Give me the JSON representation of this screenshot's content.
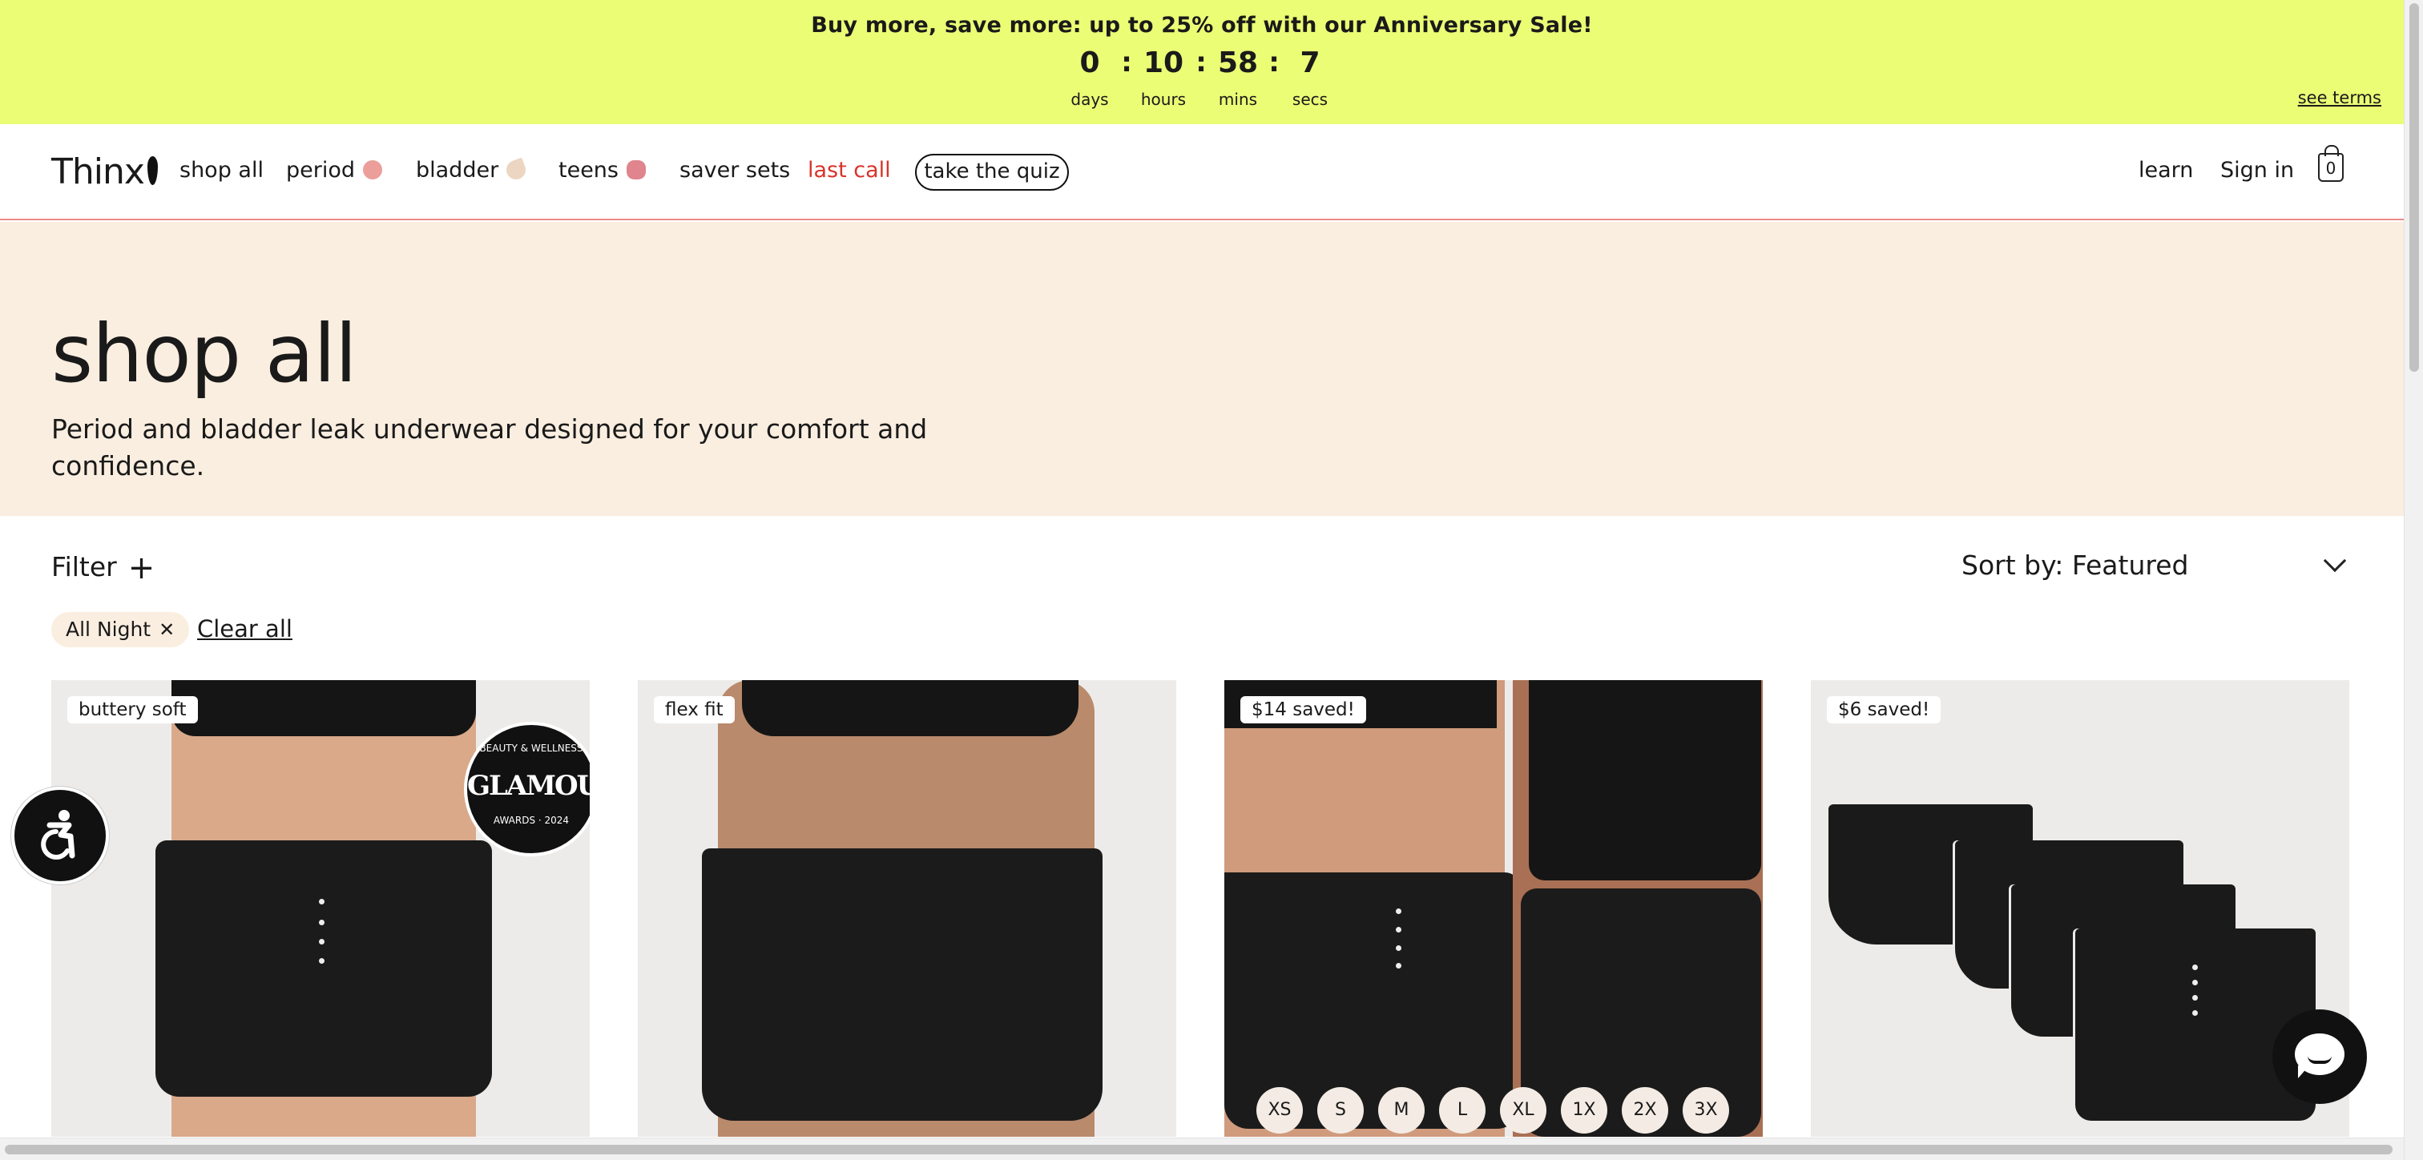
{
  "promo": {
    "text": "Buy more, save more: up to 25% off with our  Anniversary Sale!",
    "countdown": [
      {
        "value": "0",
        "label": "days"
      },
      {
        "value": "10",
        "label": "hours"
      },
      {
        "value": "58",
        "label": "mins"
      },
      {
        "value": "7",
        "label": "secs"
      }
    ],
    "separator": ":",
    "see_terms": "see terms",
    "bg_color": "#ebfd75"
  },
  "header": {
    "logo": "Thinx",
    "nav": [
      {
        "label": "shop all"
      },
      {
        "label": "period",
        "icon": "pink-circle-icon"
      },
      {
        "label": "bladder",
        "icon": "beige-drop-icon"
      },
      {
        "label": "teens",
        "icon": "pink-flower-icon"
      },
      {
        "label": "saver sets"
      },
      {
        "label": "last call",
        "color": "#d9342b"
      }
    ],
    "quiz": "take the quiz",
    "learn": "learn",
    "sign_in": "Sign in",
    "cart_count": "0"
  },
  "hero": {
    "title": "shop all",
    "subtitle": "Period and bladder leak underwear designed for your comfort and confidence.",
    "bg_color": "#faeee0"
  },
  "filters": {
    "filter_label": "Filter",
    "sort_label": "Sort by: Featured",
    "active_chip": "All Night",
    "clear_all": "Clear all"
  },
  "products": [
    {
      "badge": "buttery soft",
      "award": {
        "top": "BEAUTY & WELLNESS",
        "word": "GLAMOUR",
        "bottom": "AWARDS · 2024"
      }
    },
    {
      "badge": "flex fit"
    },
    {
      "badge": "$14 saved!",
      "sizes": [
        "XS",
        "S",
        "M",
        "L",
        "XL",
        "1X",
        "2X",
        "3X"
      ]
    },
    {
      "badge": "$6 saved!"
    }
  ]
}
